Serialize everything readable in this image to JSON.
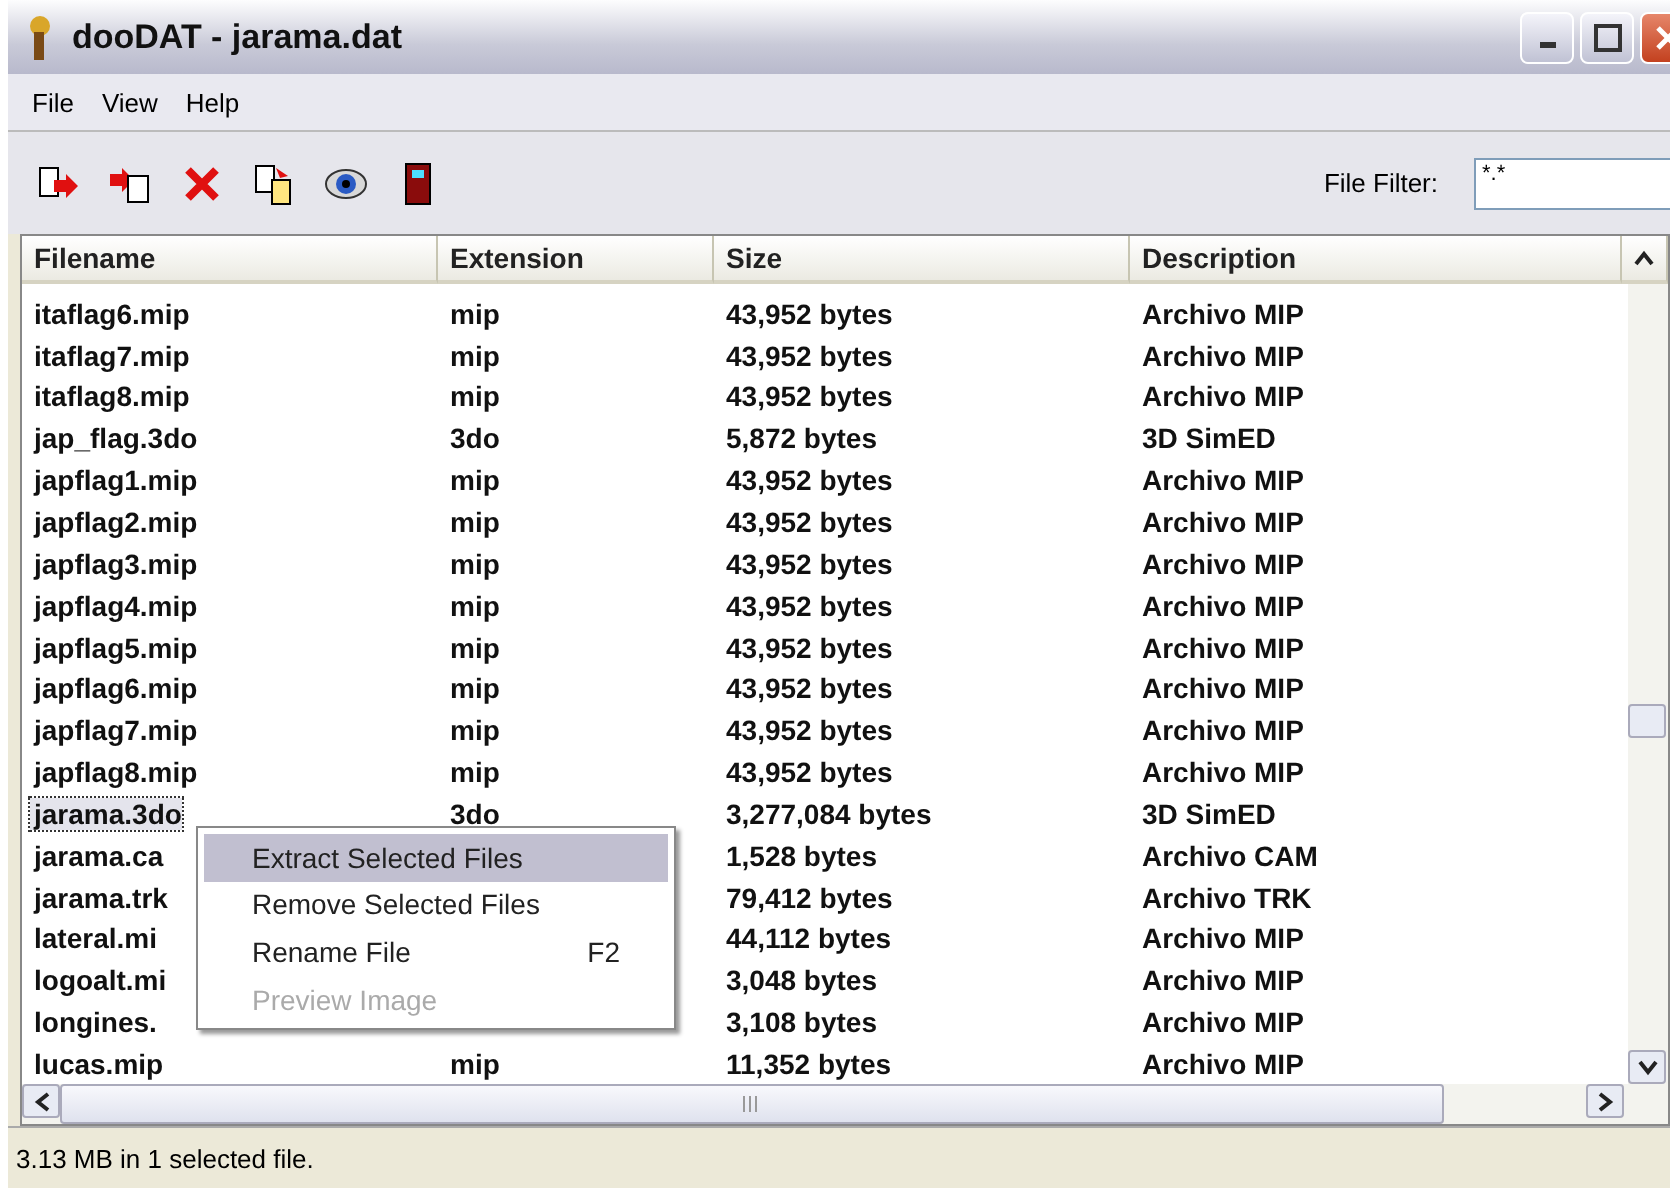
{
  "window": {
    "title": "dooDAT - jarama.dat"
  },
  "menu": [
    "File",
    "View",
    "Help"
  ],
  "toolbar": {
    "filter_label": "File Filter:",
    "filter_value": "*.*"
  },
  "table": {
    "columns": [
      "Filename",
      "Extension",
      "Size",
      "Description"
    ],
    "rows": [
      {
        "name": "itaflag6.mip",
        "ext": "mip",
        "size": "43,952 bytes",
        "desc": "Archivo MIP",
        "selected": false
      },
      {
        "name": "itaflag7.mip",
        "ext": "mip",
        "size": "43,952 bytes",
        "desc": "Archivo MIP",
        "selected": false
      },
      {
        "name": "itaflag8.mip",
        "ext": "mip",
        "size": "43,952 bytes",
        "desc": "Archivo MIP",
        "selected": false
      },
      {
        "name": "jap_flag.3do",
        "ext": "3do",
        "size": "5,872 bytes",
        "desc": "3D SimED",
        "selected": false
      },
      {
        "name": "japflag1.mip",
        "ext": "mip",
        "size": "43,952 bytes",
        "desc": "Archivo MIP",
        "selected": false
      },
      {
        "name": "japflag2.mip",
        "ext": "mip",
        "size": "43,952 bytes",
        "desc": "Archivo MIP",
        "selected": false
      },
      {
        "name": "japflag3.mip",
        "ext": "mip",
        "size": "43,952 bytes",
        "desc": "Archivo MIP",
        "selected": false
      },
      {
        "name": "japflag4.mip",
        "ext": "mip",
        "size": "43,952 bytes",
        "desc": "Archivo MIP",
        "selected": false
      },
      {
        "name": "japflag5.mip",
        "ext": "mip",
        "size": "43,952 bytes",
        "desc": "Archivo MIP",
        "selected": false
      },
      {
        "name": "japflag6.mip",
        "ext": "mip",
        "size": "43,952 bytes",
        "desc": "Archivo MIP",
        "selected": false
      },
      {
        "name": "japflag7.mip",
        "ext": "mip",
        "size": "43,952 bytes",
        "desc": "Archivo MIP",
        "selected": false
      },
      {
        "name": "japflag8.mip",
        "ext": "mip",
        "size": "43,952 bytes",
        "desc": "Archivo MIP",
        "selected": false
      },
      {
        "name": "jarama.3do",
        "ext": "3do",
        "size": "3,277,084 bytes",
        "desc": "3D SimED",
        "selected": true
      },
      {
        "name": "jarama.ca",
        "size": "1,528 bytes",
        "desc": "Archivo CAM",
        "selected": false
      },
      {
        "name": "jarama.trk",
        "size": "79,412 bytes",
        "desc": "Archivo TRK",
        "selected": false
      },
      {
        "name": "lateral.mi",
        "size": "44,112 bytes",
        "desc": "Archivo MIP",
        "selected": false
      },
      {
        "name": "logoalt.mi",
        "size": "3,048 bytes",
        "desc": "Archivo MIP",
        "selected": false
      },
      {
        "name": "longines.",
        "size": "3,108 bytes",
        "desc": "Archivo MIP",
        "selected": false
      },
      {
        "name": "lucas.mip",
        "ext": "mip",
        "size": "11,352 bytes",
        "desc": "Archivo MIP",
        "selected": false
      }
    ]
  },
  "context_menu": [
    {
      "label": "Extract Selected Files",
      "selected": true,
      "disabled": false
    },
    {
      "label": "Remove Selected Files",
      "selected": false,
      "disabled": false
    },
    {
      "label": "Rename File",
      "shortcut": "F2",
      "selected": false,
      "disabled": false
    },
    {
      "label": "Preview Image",
      "selected": false,
      "disabled": true
    }
  ],
  "status_bar": "3.13 MB in 1 selected file."
}
